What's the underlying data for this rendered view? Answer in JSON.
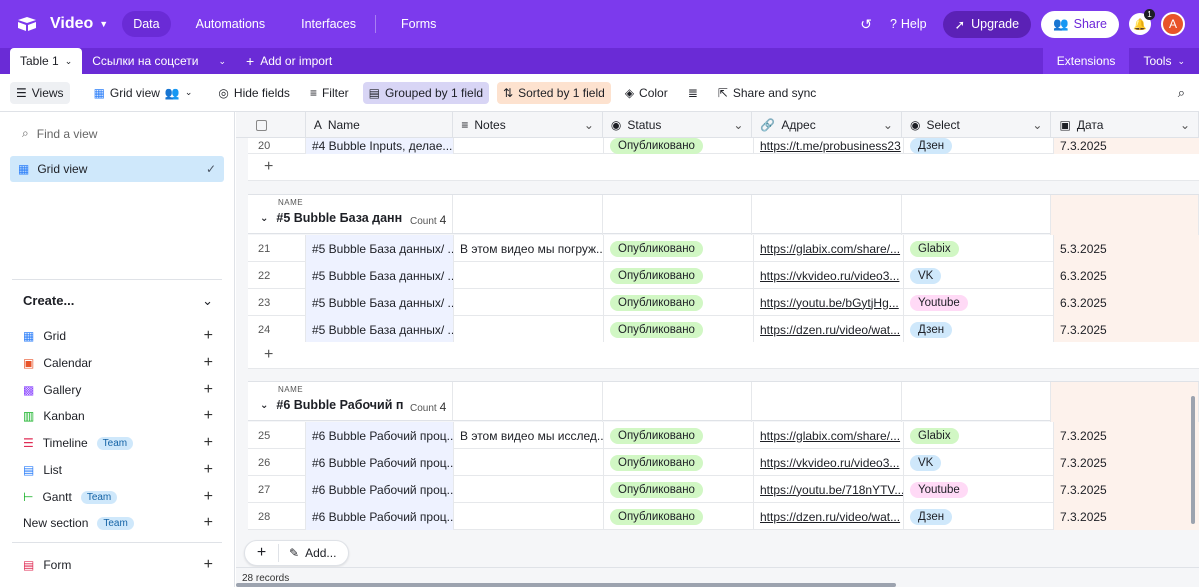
{
  "topbar": {
    "base_name": "Video",
    "tabs": [
      {
        "label": "Data",
        "active": true
      },
      {
        "label": "Automations",
        "active": false
      },
      {
        "label": "Interfaces",
        "active": false
      },
      {
        "label": "Forms",
        "active": false
      }
    ],
    "help": "Help",
    "upgrade": "Upgrade",
    "share": "Share",
    "notifications": "1",
    "avatar": "A"
  },
  "tables": {
    "active": "Table 1",
    "other": "Ссылки на соцсети",
    "add": "Add or import",
    "extensions": "Extensions",
    "tools": "Tools"
  },
  "toolbar": {
    "views": "Views",
    "grid_view": "Grid view",
    "hide_fields": "Hide fields",
    "filter": "Filter",
    "grouped": "Grouped by 1 field",
    "sorted": "Sorted by 1 field",
    "color": "Color",
    "share_sync": "Share and sync"
  },
  "sidebar": {
    "find_placeholder": "Find a view",
    "active_view": "Grid view",
    "create": "Create...",
    "items": [
      {
        "label": "Grid",
        "team": false,
        "icon": "grid-icon",
        "color": "#2d7ff9"
      },
      {
        "label": "Calendar",
        "team": false,
        "icon": "calendar-icon",
        "color": "#e8542a"
      },
      {
        "label": "Gallery",
        "team": false,
        "icon": "gallery-icon",
        "color": "#8b46ff"
      },
      {
        "label": "Kanban",
        "team": false,
        "icon": "kanban-icon",
        "color": "#11af22"
      },
      {
        "label": "Timeline",
        "team": true,
        "icon": "timeline-icon",
        "color": "#e02e56"
      },
      {
        "label": "List",
        "team": false,
        "icon": "list-icon",
        "color": "#2d7ff9"
      },
      {
        "label": "Gantt",
        "team": true,
        "icon": "gantt-icon",
        "color": "#11af22"
      },
      {
        "label": "New section",
        "team": true,
        "icon": "",
        "color": ""
      }
    ],
    "team_label": "Team",
    "form": "Form"
  },
  "columns": [
    "Name",
    "Notes",
    "Status",
    "Адрес",
    "Select",
    "Дата"
  ],
  "top_row": {
    "num": "20",
    "name": "#4 Bubble Inputs, делае...",
    "notes": "",
    "status": "Опубликовано",
    "addr": "https://t.me/probusiness23",
    "select": "Дзен",
    "date": "7.3.2025"
  },
  "groups": [
    {
      "label": "NAME",
      "name": "#5 Bubble База данн",
      "count_label": "Count",
      "count": "4",
      "rows": [
        {
          "num": "21",
          "name": "#5 Bubble База данных/ ...",
          "notes": "В этом видео мы погруж...",
          "status": "Опубликовано",
          "addr": "https://glabix.com/share/...",
          "select": "Glabix",
          "date": "5.3.2025"
        },
        {
          "num": "22",
          "name": "#5 Bubble База данных/ ...",
          "notes": "",
          "status": "Опубликовано",
          "addr": "https://vkvideo.ru/video3...",
          "select": "VK",
          "date": "6.3.2025"
        },
        {
          "num": "23",
          "name": "#5 Bubble База данных/ ...",
          "notes": "",
          "status": "Опубликовано",
          "addr": "https://youtu.be/bGytjHg...",
          "select": "Youtube",
          "date": "6.3.2025"
        },
        {
          "num": "24",
          "name": "#5 Bubble База данных/ ...",
          "notes": "",
          "status": "Опубликовано",
          "addr": "https://dzen.ru/video/wat...",
          "select": "Дзен",
          "date": "7.3.2025"
        }
      ]
    },
    {
      "label": "NAME",
      "name": "#6 Bubble Рабочий п",
      "count_label": "Count",
      "count": "4",
      "rows": [
        {
          "num": "25",
          "name": "#6 Bubble Рабочий проц...",
          "notes": "В этом видео мы исслед...",
          "status": "Опубликовано",
          "addr": "https://glabix.com/share/...",
          "select": "Glabix",
          "date": "7.3.2025"
        },
        {
          "num": "26",
          "name": "#6 Bubble Рабочий проц...",
          "notes": "",
          "status": "Опубликовано",
          "addr": "https://vkvideo.ru/video3...",
          "select": "VK",
          "date": "7.3.2025"
        },
        {
          "num": "27",
          "name": "#6 Bubble Рабочий проц...",
          "notes": "",
          "status": "Опубликовано",
          "addr": "https://youtu.be/718nYTV...",
          "select": "Youtube",
          "date": "7.3.2025"
        },
        {
          "num": "28",
          "name": "#6 Bubble Рабочий проц...",
          "notes": "",
          "status": "Опубликовано",
          "addr": "https://dzen.ru/video/wat...",
          "select": "Дзен",
          "date": "7.3.2025"
        }
      ]
    }
  ],
  "add_label": "Add...",
  "records": "28 records"
}
